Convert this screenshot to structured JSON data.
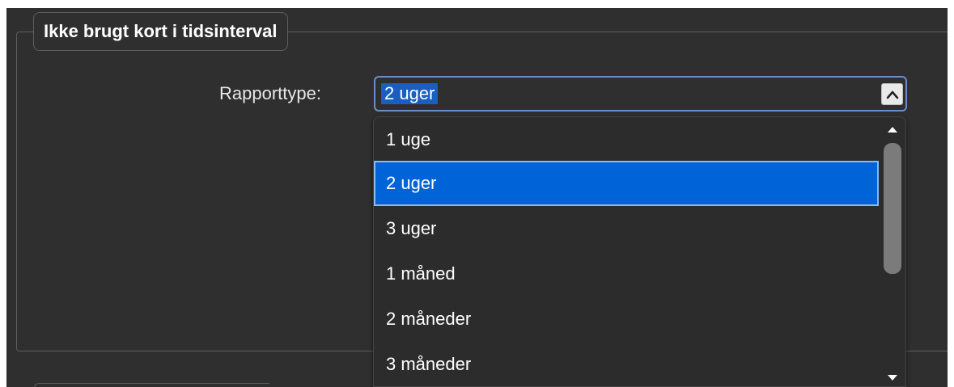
{
  "group": {
    "title": "Ikke brugt kort i tidsinterval"
  },
  "report": {
    "label": "Rapporttype:",
    "selected_value": "2 uger",
    "options": [
      "1 uge",
      "2 uger",
      "3 uger",
      "1 måned",
      "2 måneder",
      "3 måneder"
    ],
    "selected_index": 1
  },
  "icons": {
    "combo_toggle": "chevron-up-icon",
    "scroll_up": "triangle-up-icon",
    "scroll_down": "triangle-down-icon"
  },
  "colors": {
    "background": "#2f2f2f",
    "selection": "#0064d8",
    "combo_border": "#6a8fc8"
  }
}
